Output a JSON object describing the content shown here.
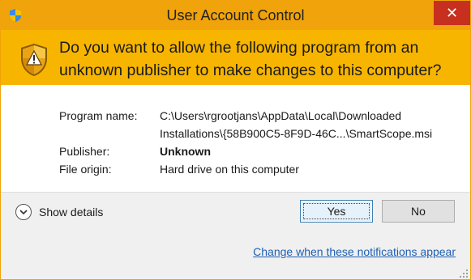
{
  "window": {
    "title": "User Account Control",
    "close_glyph": "✕",
    "accent_color": "#f0a30a",
    "banner_color": "#f7b500",
    "close_color": "#c7301e"
  },
  "banner": {
    "line1": "Do you want to allow the following program from an",
    "line2": "unknown publisher to make changes to this computer?",
    "icon": "warning-shield-icon"
  },
  "details": {
    "program_name_label": "Program name:",
    "program_name_line1": "C:\\Users\\rgrootjans\\AppData\\Local\\Downloaded",
    "program_name_line2": "Installations\\{58B900C5-8F9D-46C...\\SmartScope.msi",
    "publisher_label": "Publisher:",
    "publisher_value": "Unknown",
    "file_origin_label": "File origin:",
    "file_origin_value": "Hard drive on this computer"
  },
  "footer": {
    "show_details_label": "Show details",
    "yes_label": "Yes",
    "no_label": "No",
    "link_label": "Change when these notifications appear"
  }
}
